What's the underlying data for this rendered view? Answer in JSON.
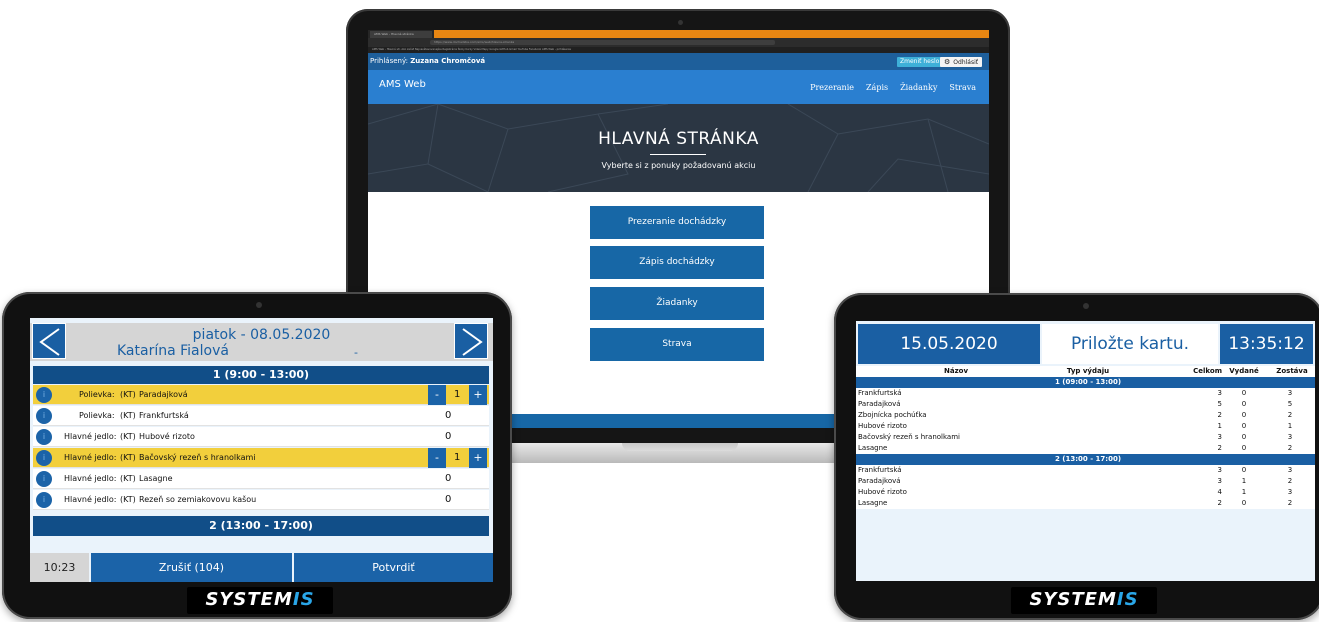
{
  "laptop": {
    "browser_tab": "AMS Web - Hlavná stránka",
    "url": "https://www.dochadzka.com/ams/web/hlavna-stranka",
    "bookmarks": "AMS Web - Hlavná str.   Ako začať   Najnavštevovanejšie   Registrácia   Školy   Kurzy   Videá   Mapy Google   GitHub   Gmail   YouTube   Facebook   AMS Web - prihlásenie",
    "user_label": "Prihlásený:",
    "user_name": "Zuzana Chromčová",
    "change_password": "Zmeniť heslo",
    "logout": "Odhlásiť",
    "brand": "AMS Web",
    "nav": [
      "Prezeranie",
      "Zápis",
      "Žiadanky",
      "Strava"
    ],
    "hero_title": "HLAVNÁ STRÁNKA",
    "hero_subtitle": "Vyberte si z ponuky požadovanú akciu",
    "buttons": [
      "Prezeranie dochádzky",
      "Zápis dochádzky",
      "Žiadanky",
      "Strava"
    ]
  },
  "left_tablet": {
    "date": "piatok - 08.05.2020",
    "person": "Katarína Fialová",
    "dash": "-",
    "section1": "1 (9:00 - 13:00)",
    "section2": "2 (13:00 - 17:00)",
    "rows": [
      {
        "type": "Polievka:",
        "code": "(KT)",
        "name": "Paradajková",
        "qty": "1",
        "highlight": true
      },
      {
        "type": "Polievka:",
        "code": "(KT)",
        "name": "Frankfurtská",
        "qty": "0",
        "highlight": false
      },
      {
        "type": "Hlavné jedlo:",
        "code": "(KT)",
        "name": "Hubové rizoto",
        "qty": "0",
        "highlight": false
      },
      {
        "type": "Hlavné jedlo:",
        "code": "(KT)",
        "name": "Bačovský rezeň s hranolkami",
        "qty": "1",
        "highlight": true
      },
      {
        "type": "Hlavné jedlo:",
        "code": "(KT)",
        "name": "Lasagne",
        "qty": "0",
        "highlight": false
      },
      {
        "type": "Hlavné jedlo:",
        "code": "(KT)",
        "name": "Rezeň so zemiakovovu kašou",
        "qty": "0",
        "highlight": false
      }
    ],
    "info_glyph": "i",
    "minus": "-",
    "plus": "+",
    "time": "10:23",
    "cancel": "Zrušiť (104)",
    "confirm": "Potvrdiť",
    "logo_a": "SYSTEM",
    "logo_b": "IS"
  },
  "right_tablet": {
    "date": "15.05.2020",
    "message": "Priložte kartu.",
    "clock": "13:35:12",
    "headers": {
      "name": "Názov",
      "type": "Typ výdaju",
      "total": "Celkom",
      "issued": "Vydané",
      "remaining": "Zostáva"
    },
    "section1": "1 (09:00 - 13:00)",
    "section2": "2 (13:00 - 17:00)",
    "rows1": [
      {
        "name": "Frankfurtská",
        "total": "3",
        "issued": "0",
        "remaining": "3"
      },
      {
        "name": "Paradajková",
        "total": "5",
        "issued": "0",
        "remaining": "5"
      },
      {
        "name": "Zbojnícka pochúťka",
        "total": "2",
        "issued": "0",
        "remaining": "2"
      },
      {
        "name": "Hubové rizoto",
        "total": "1",
        "issued": "0",
        "remaining": "1"
      },
      {
        "name": "Bačovský rezeň s hranolkami",
        "total": "3",
        "issued": "0",
        "remaining": "3"
      },
      {
        "name": "Lasagne",
        "total": "2",
        "issued": "0",
        "remaining": "2"
      }
    ],
    "rows2": [
      {
        "name": "Frankfurtská",
        "total": "3",
        "issued": "0",
        "remaining": "3"
      },
      {
        "name": "Paradajková",
        "total": "3",
        "issued": "1",
        "remaining": "2"
      },
      {
        "name": "Hubové rizoto",
        "total": "4",
        "issued": "1",
        "remaining": "3"
      },
      {
        "name": "Lasagne",
        "total": "2",
        "issued": "0",
        "remaining": "2"
      }
    ],
    "logo_a": "SYSTEM",
    "logo_b": "IS"
  },
  "colors": {
    "primary": "#1a5fa3",
    "nav": "#2a7fd0",
    "highlight": "#f2cf3c",
    "hero": "#2b3643"
  }
}
